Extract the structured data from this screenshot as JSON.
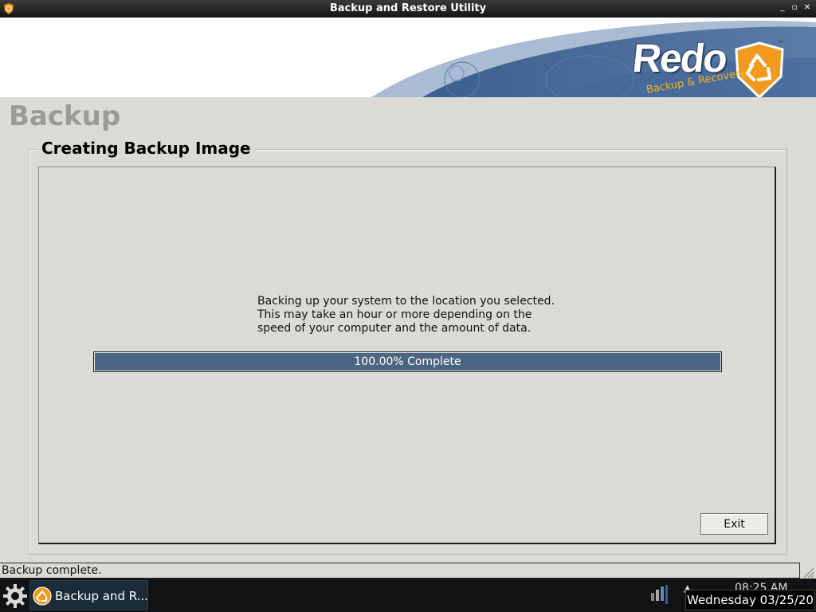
{
  "window": {
    "title": "Backup and Restore Utility",
    "buttons": [
      "minimize",
      "maximize",
      "close"
    ]
  },
  "banner": {
    "logo_word": "Redo",
    "logo_tagline": "Backup & Recovery",
    "trademark": "™"
  },
  "page": {
    "heading": "Backup",
    "group_title": "Creating Backup Image",
    "description_lines": [
      "Backing up your system to the location you selected.",
      "This may take an hour or more depending on the",
      "speed of your computer and the amount of data."
    ],
    "progress": {
      "percent": 100,
      "label": "100.00% Complete"
    },
    "exit_label": "Exit"
  },
  "statusbar": {
    "text": "Backup complete."
  },
  "taskbar": {
    "task_label": "Backup and R...",
    "clock": "08:25 AM",
    "date_tooltip": "Wednesday 03/25/20"
  },
  "colors": {
    "progress_fill": "#4a6682",
    "banner_wave": "#4a6a96",
    "logo_orange": "#f39a1e"
  }
}
